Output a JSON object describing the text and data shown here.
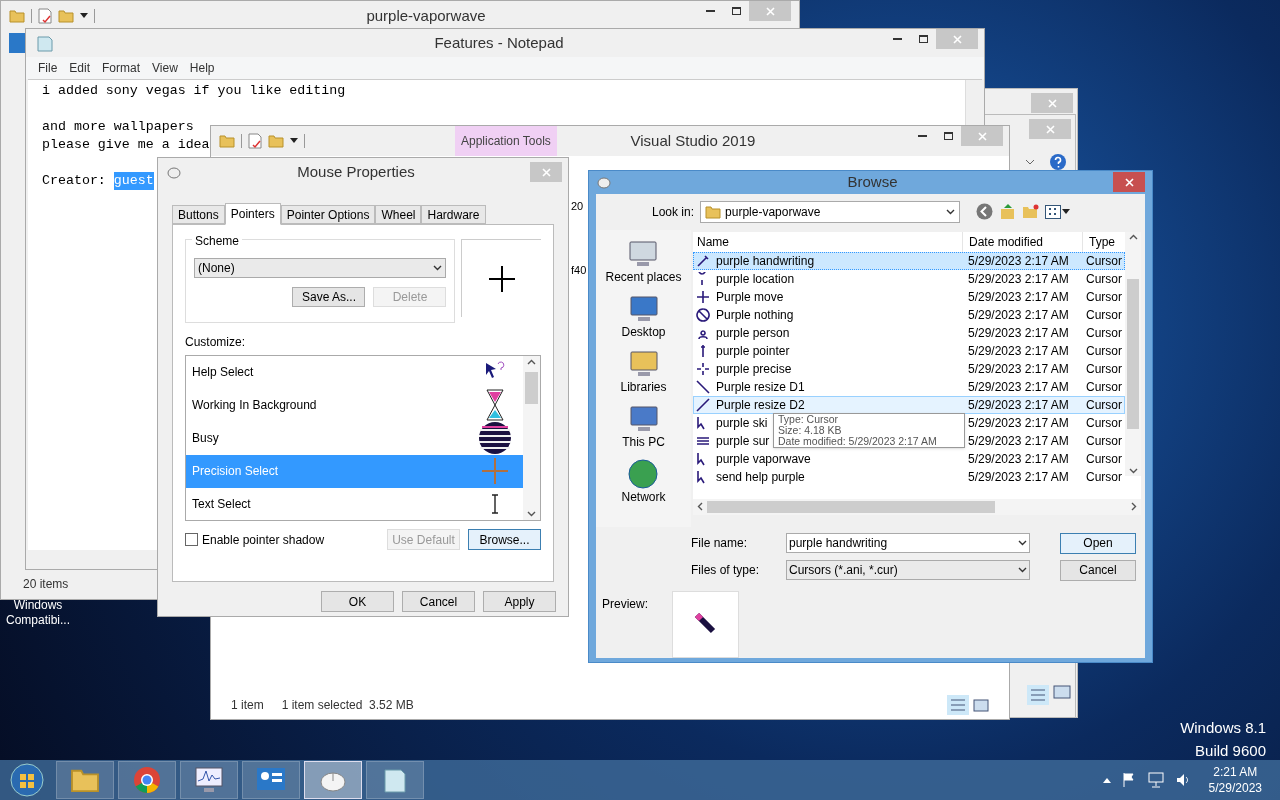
{
  "desktop": {
    "icon_label": "Windows Compatibi...",
    "os_lines": [
      "Windows 8.1",
      "Build 9600"
    ]
  },
  "explorer": {
    "title": "purple-vaporwave",
    "status": "20 items"
  },
  "notepad": {
    "title": "Features - Notepad",
    "menu": [
      "File",
      "Edit",
      "Format",
      "View",
      "Help"
    ],
    "paragraphs": [
      [
        "i added sony vegas if you like editing"
      ],
      [
        "and more wallpapers",
        "please give me a idea"
      ]
    ],
    "creator": {
      "label": "Creator:",
      "selection": "guest"
    }
  },
  "visual_studio": {
    "title": "Visual Studio 2019",
    "context_tab": "Application Tools",
    "peek": [
      "20",
      "f40"
    ],
    "status": [
      "1 item",
      "1 item selected  3.52 MB"
    ]
  },
  "mouse_properties": {
    "title": "Mouse Properties",
    "tabs": [
      {
        "label": "Buttons",
        "selected": false
      },
      {
        "label": "Pointers",
        "selected": true
      },
      {
        "label": "Pointer Options",
        "selected": false
      },
      {
        "label": "Wheel",
        "selected": false
      },
      {
        "label": "Hardware",
        "selected": false
      }
    ],
    "scheme": {
      "label": "Scheme",
      "value": "(None)",
      "buttons": [
        {
          "label": "Save As...",
          "disabled": false
        },
        {
          "label": "Delete",
          "disabled": true
        }
      ]
    },
    "customize_label": "Customize:",
    "pointers": [
      {
        "name": "Help Select",
        "selected": false
      },
      {
        "name": "Working In Background",
        "selected": false
      },
      {
        "name": "Busy",
        "selected": false
      },
      {
        "name": "Precision Select",
        "selected": true
      },
      {
        "name": "Text Select",
        "selected": false
      }
    ],
    "shadow": {
      "label": "Enable pointer shadow",
      "checked": false
    },
    "use_default": {
      "label": "Use Default",
      "disabled": true
    },
    "browse": {
      "label": "Browse...",
      "disabled": false
    },
    "buttons": [
      "OK",
      "Cancel",
      "Apply"
    ]
  },
  "browse": {
    "title": "Browse",
    "look_in_label": "Look in:",
    "look_in_value": "purple-vaporwave",
    "places": [
      "Recent places",
      "Desktop",
      "Libraries",
      "This PC",
      "Network"
    ],
    "columns": [
      "Name",
      "Date modified",
      "Type"
    ],
    "rows": [
      {
        "name": "purple handwriting",
        "date": "5/29/2023 2:17 AM",
        "type": "Cursor",
        "selected": true,
        "hovered": false
      },
      {
        "name": "purple location",
        "date": "5/29/2023 2:17 AM",
        "type": "Cursor",
        "selected": false,
        "hovered": false
      },
      {
        "name": "Purple move",
        "date": "5/29/2023 2:17 AM",
        "type": "Cursor",
        "selected": false,
        "hovered": false
      },
      {
        "name": "Purple nothing",
        "date": "5/29/2023 2:17 AM",
        "type": "Cursor",
        "selected": false,
        "hovered": false
      },
      {
        "name": "purple person",
        "date": "5/29/2023 2:17 AM",
        "type": "Cursor",
        "selected": false,
        "hovered": false
      },
      {
        "name": "purple pointer",
        "date": "5/29/2023 2:17 AM",
        "type": "Cursor",
        "selected": false,
        "hovered": false
      },
      {
        "name": "purple precise",
        "date": "5/29/2023 2:17 AM",
        "type": "Cursor",
        "selected": false,
        "hovered": false
      },
      {
        "name": "Purple resize D1",
        "date": "5/29/2023 2:17 AM",
        "type": "Cursor",
        "selected": false,
        "hovered": false
      },
      {
        "name": "Purple resize D2",
        "date": "5/29/2023 2:17 AM",
        "type": "Cursor",
        "selected": false,
        "hovered": true
      },
      {
        "name": "purple ski",
        "date": "5/29/2023 2:17 AM",
        "type": "Cursor",
        "selected": false,
        "hovered": false
      },
      {
        "name": "purple sur",
        "date": "5/29/2023 2:17 AM",
        "type": "Cursor",
        "selected": false,
        "hovered": false
      },
      {
        "name": "purple vaporwave",
        "date": "5/29/2023 2:17 AM",
        "type": "Cursor",
        "selected": false,
        "hovered": false
      },
      {
        "name": "send help purple",
        "date": "5/29/2023 2:17 AM",
        "type": "Cursor",
        "selected": false,
        "hovered": false
      }
    ],
    "tooltip": [
      "Type: Cursor",
      "Size: 4.18 KB",
      "Date modified: 5/29/2023 2:17 AM"
    ],
    "file_name_label": "File name:",
    "file_name_value": "purple handwriting",
    "file_type_label": "Files of type:",
    "file_type_value": "Cursors (*.ani, *.cur)",
    "buttons": [
      "Open",
      "Cancel"
    ],
    "preview_label": "Preview:"
  },
  "taskbar": {
    "buttons": [
      {
        "selected": false
      },
      {
        "selected": false
      },
      {
        "selected": false
      },
      {
        "selected": false
      },
      {
        "selected": true
      },
      {
        "selected": false
      }
    ],
    "time": "2:21 AM",
    "date": "5/29/2023"
  }
}
